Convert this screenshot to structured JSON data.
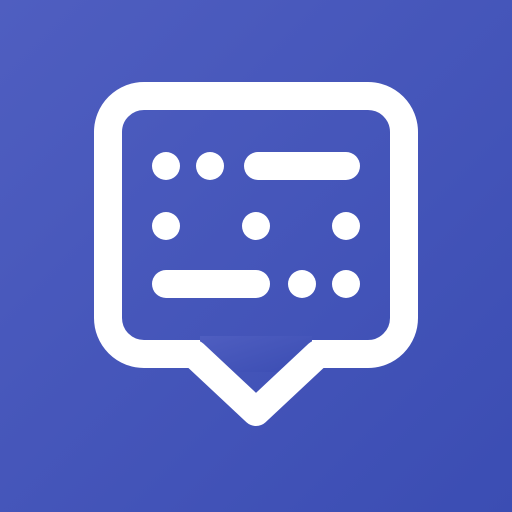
{
  "icon": {
    "name": "morse-code-chat-bubble-icon",
    "background_start": "#4F5EC0",
    "background_end": "#3B4DB3",
    "glyph_color": "#FFFFFF",
    "morse_rows": [
      [
        "dot",
        "dot",
        "dash"
      ],
      [
        "dot",
        "dot",
        "dot"
      ],
      [
        "dash",
        "dot",
        "dot"
      ]
    ]
  }
}
